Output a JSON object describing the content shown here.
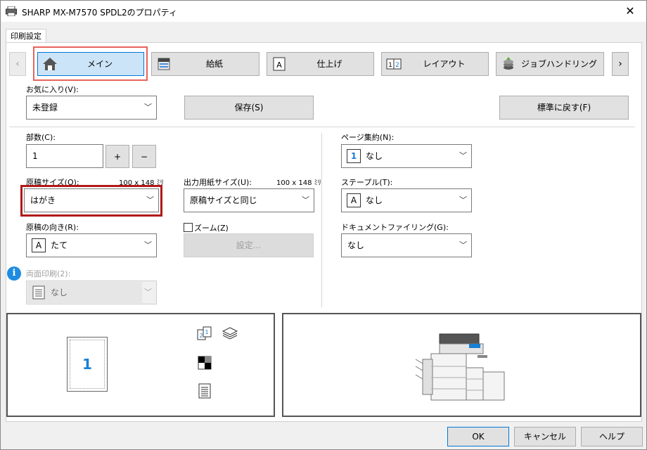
{
  "window": {
    "title": "SHARP MX-M7570 SPDL2のプロパティ",
    "close": "✕"
  },
  "tab_strip": {
    "label": "印刷設定"
  },
  "nav": {
    "prev": "‹",
    "next": "›"
  },
  "tabs": [
    {
      "label": "メイン",
      "icon": "house-icon"
    },
    {
      "label": "給紙",
      "icon": "paper-tray-icon"
    },
    {
      "label": "仕上げ",
      "icon": "finish-icon"
    },
    {
      "label": "レイアウト",
      "icon": "layout-icon"
    },
    {
      "label": "ジョブハンドリング",
      "icon": "job-handling-icon"
    }
  ],
  "favorites": {
    "label": "お気に入り(V):",
    "value": "未登録",
    "save_label": "保存(S)",
    "reset_label": "標準に戻す(F)"
  },
  "copies": {
    "label": "部数(C):",
    "value": "1",
    "plus": "+",
    "minus": "−"
  },
  "original_size": {
    "label": "原稿サイズ(O):",
    "dims": "100 x 148 ﾐﾘ",
    "value": "はがき"
  },
  "output_size": {
    "label": "出力用紙サイズ(U):",
    "dims": "100 x 148 ﾐﾘ",
    "value": "原稿サイズと同じ"
  },
  "orientation": {
    "label": "原稿の向き(R):",
    "icon_text": "A",
    "value": "たて"
  },
  "zoom": {
    "label": "ズーム(Z)",
    "settings_label": "設定..."
  },
  "duplex": {
    "label": "両面印刷(2):",
    "value": "なし",
    "info": "i"
  },
  "n_up": {
    "label": "ページ集約(N):",
    "icon_text": "1",
    "value": "なし"
  },
  "staple": {
    "label": "ステープル(T):",
    "icon_text": "A",
    "value": "なし"
  },
  "doc_filing": {
    "label": "ドキュメントファイリング(G):",
    "value": "なし"
  },
  "preview": {
    "page_number": "1"
  },
  "footer": {
    "ok": "OK",
    "cancel": "キャンセル",
    "help": "ヘルプ"
  },
  "colors": {
    "accent": "#0078d7",
    "active_tab_bg": "#cce4f7",
    "highlight_red": "#b01919",
    "tab_highlight": "#e8625d",
    "page_number": "#1a7fd4"
  }
}
